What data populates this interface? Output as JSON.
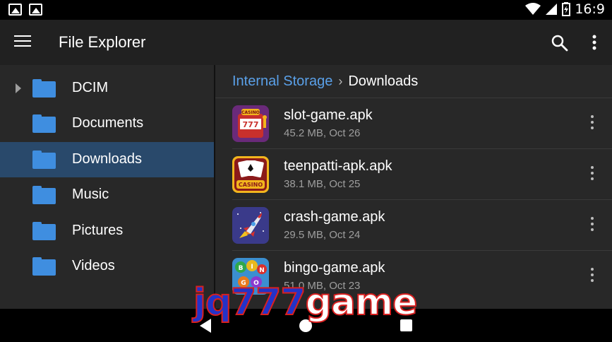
{
  "status_bar": {
    "time": "16:9",
    "left_icons": [
      "image-icon",
      "image-icon"
    ],
    "right_icons": [
      "wifi-icon",
      "signal-icon",
      "battery-icon"
    ]
  },
  "app_bar": {
    "title": "File Explorer",
    "icons": {
      "menu": "menu-icon",
      "search": "search-icon",
      "more": "more-vert-icon"
    }
  },
  "sidebar": {
    "items": [
      {
        "label": "DCIM",
        "expandable": true,
        "active": false
      },
      {
        "label": "Documents",
        "expandable": false,
        "active": false
      },
      {
        "label": "Downloads",
        "expandable": false,
        "active": true
      },
      {
        "label": "Music",
        "expandable": false,
        "active": false
      },
      {
        "label": "Pictures",
        "expandable": false,
        "active": false
      },
      {
        "label": "Videos",
        "expandable": false,
        "active": false
      }
    ]
  },
  "breadcrumb": {
    "root": "Internal Storage",
    "separator": "›",
    "current": "Downloads"
  },
  "files": [
    {
      "name": "slot-game.apk",
      "meta": "45.2 MB, Oct 26",
      "icon": "slot-machine-icon"
    },
    {
      "name": "teenpatti-apk.apk",
      "meta": "38.1 MB, Oct 25",
      "icon": "casino-cards-icon"
    },
    {
      "name": "crash-game.apk",
      "meta": "29.5 MB, Oct 24",
      "icon": "rocket-icon"
    },
    {
      "name": "bingo-game.apk",
      "meta": "51.0 MB, Oct 23",
      "icon": "bingo-balls-icon"
    }
  ],
  "icon_text": {
    "slot": "CASINO",
    "slot_reels": "777",
    "teenpatti": "CASINO",
    "bingo": [
      "B",
      "I",
      "N",
      "G",
      "O"
    ]
  },
  "watermark": {
    "part1": "jq777",
    "part2": "game"
  },
  "nav_bar": {
    "icons": [
      "back-icon",
      "home-icon",
      "recents-icon"
    ]
  },
  "colors": {
    "accent": "#3f8ee0",
    "selected_bg": "#29496b",
    "breadcrumb_link": "#5aa0e8",
    "panel_bg": "#282828",
    "appbar_bg": "#212121"
  }
}
